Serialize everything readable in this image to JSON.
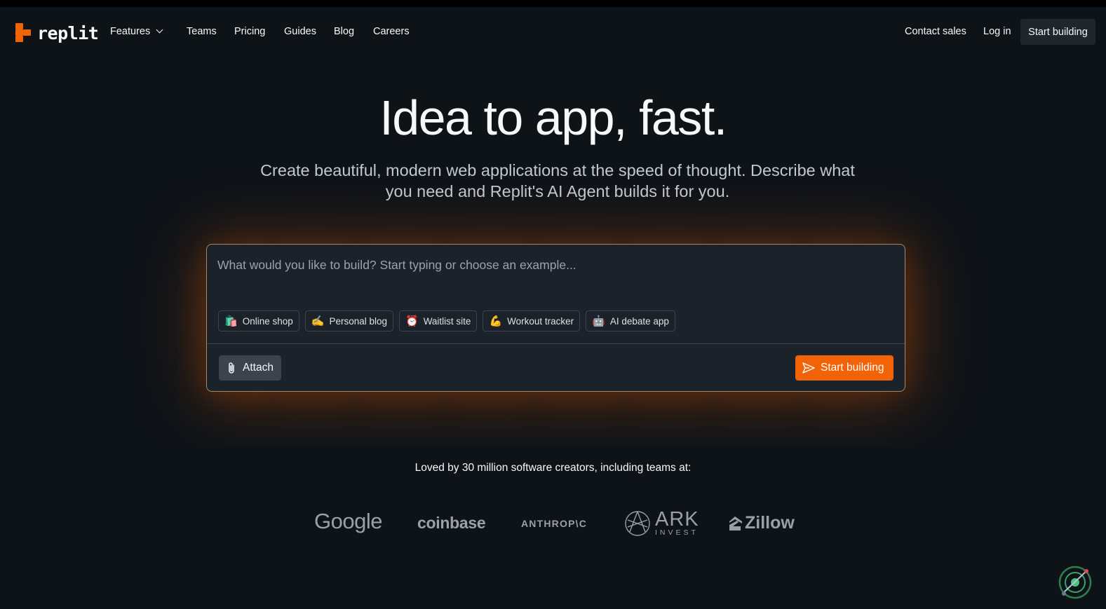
{
  "brand": {
    "name": "replit",
    "accent": "#f26207"
  },
  "nav": {
    "features": "Features",
    "teams": "Teams",
    "pricing": "Pricing",
    "guides": "Guides",
    "blog": "Blog",
    "careers": "Careers",
    "contact_sales": "Contact sales",
    "log_in": "Log in",
    "start_building": "Start building"
  },
  "hero": {
    "title": "Idea to app, fast.",
    "subtitle": "Create beautiful, modern web applications at the speed of thought. Describe what you need and Replit's AI Agent builds it for you."
  },
  "prompt": {
    "placeholder": "What would you like to build? Start typing or choose an example...",
    "value": "",
    "examples": [
      {
        "emoji": "🛍️",
        "label": "Online shop"
      },
      {
        "emoji": "✍️",
        "label": "Personal blog"
      },
      {
        "emoji": "⏰",
        "label": "Waitlist site"
      },
      {
        "emoji": "💪",
        "label": "Workout tracker"
      },
      {
        "emoji": "🤖",
        "label": "AI debate app"
      }
    ],
    "attach_label": "Attach",
    "submit_label": "Start building"
  },
  "social_proof": {
    "text": "Loved by 30 million software creators, including teams at:",
    "logos": {
      "google": "Google",
      "coinbase": "coinbase",
      "anthropic": "ANTHROP\\C",
      "ark_main": "ARK",
      "ark_sub": "INVEST",
      "zillow": "Zillow"
    }
  }
}
